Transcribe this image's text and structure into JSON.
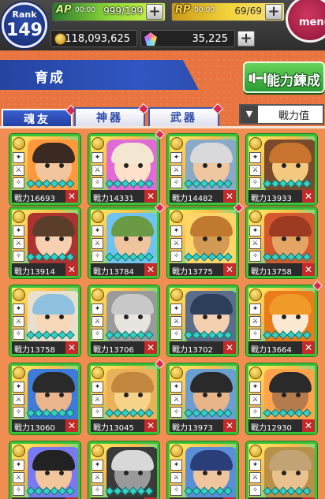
{
  "header": {
    "rank_label": "Rank",
    "rank_value": "149",
    "ap": {
      "label": "AP",
      "timer": "00:00",
      "value": "999/199"
    },
    "rp": {
      "label": "RP",
      "timer": "00:00",
      "value": "69/69"
    },
    "coins": "118,093,625",
    "gems": "35,225",
    "plus_label": "+",
    "menu_label": "menu"
  },
  "page": {
    "title": "育成",
    "training_button": "能力鍊成"
  },
  "tabs": [
    {
      "label": "魂友",
      "active": true
    },
    {
      "label": "神器",
      "active": false
    },
    {
      "label": "武器",
      "active": false
    }
  ],
  "sort": {
    "arrow": "▼",
    "label": "戰力值"
  },
  "power_prefix": "戰力",
  "cards": [
    {
      "power": "16693",
      "hair": "#3b2a22",
      "skin": "#f2c59d",
      "bg": "#ff9a3c"
    },
    {
      "power": "14331",
      "hair": "#f3e7d2",
      "skin": "#ffe0c8",
      "bg": "#e06ad6"
    },
    {
      "power": "14482",
      "hair": "#d9d9dc",
      "skin": "#f0c6a0",
      "bg": "#8aa9c8"
    },
    {
      "power": "13933",
      "hair": "#c9742e",
      "skin": "#f3c97f",
      "bg": "#7a4a2a"
    },
    {
      "power": "13914",
      "hair": "#5b3e2a",
      "skin": "#f6d0b0",
      "bg": "#ad3330"
    },
    {
      "power": "13784",
      "hair": "#6b9a45",
      "skin": "#f0c49c",
      "bg": "#6fc3ef"
    },
    {
      "power": "13775",
      "hair": "#c07a2f",
      "skin": "#d39a54",
      "bg": "#ffd56a"
    },
    {
      "power": "13758",
      "hair": "#9c3b22",
      "skin": "#e3a466",
      "bg": "#d4592e"
    },
    {
      "power": "13758",
      "hair": "#8ec0e0",
      "skin": "#f6d7b7",
      "bg": "#e8e0cc"
    },
    {
      "power": "13706",
      "hair": "#c8c8c8",
      "skin": "#e8e4df",
      "bg": "#9a9a9a"
    },
    {
      "power": "13702",
      "hair": "#2c3e5a",
      "skin": "#f3d0b0",
      "bg": "#5b6d8a"
    },
    {
      "power": "13664",
      "hair": "#f09a2a",
      "skin": "#fbe9d2",
      "bg": "#ea7b1a"
    },
    {
      "power": "13060",
      "hair": "#2a2a2a",
      "skin": "#eab58c",
      "bg": "#3f7bd8"
    },
    {
      "power": "13045",
      "hair": "#c2863e",
      "skin": "#f7d38a",
      "bg": "#e8b15a"
    },
    {
      "power": "13973",
      "hair": "#2a2a2a",
      "skin": "#e8b588",
      "bg": "#6d9ed1"
    },
    {
      "power": "12930",
      "hair": "#2a2a2a",
      "skin": "#b67b4d",
      "bg": "#ffa24c"
    },
    {
      "power": "",
      "hair": "#222",
      "skin": "#f2c59d",
      "bg": "#7a7af0"
    },
    {
      "power": "",
      "hair": "#d8d8d8",
      "skin": "#9a9a9a",
      "bg": "#3a3a3a"
    },
    {
      "power": "",
      "hair": "#2a3f7a",
      "skin": "#f0c49c",
      "bg": "#5b8ed8"
    },
    {
      "power": "",
      "hair": "#c2a373",
      "skin": "#e9c18e",
      "bg": "#b9904a"
    }
  ],
  "colors": {
    "accent_blue": "#2c4ba7",
    "card_border": "#3cc13a",
    "notification": "#d6284c"
  }
}
